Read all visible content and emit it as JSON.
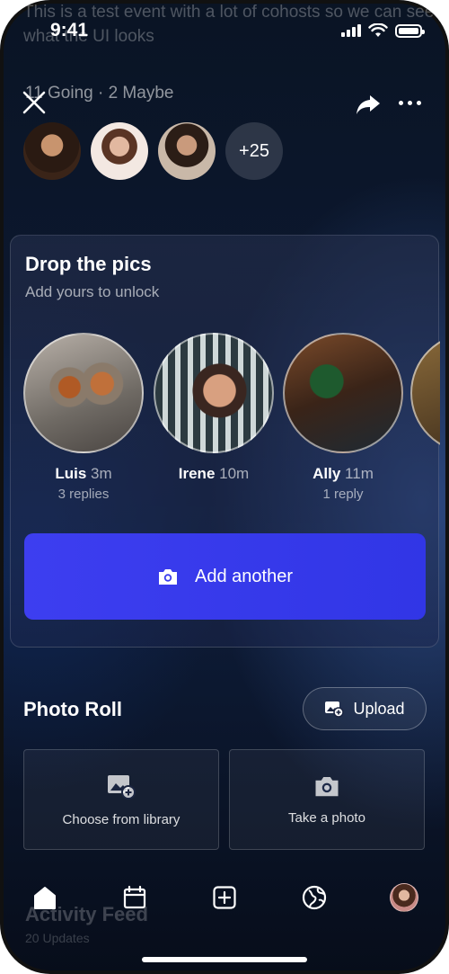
{
  "background": {
    "description": "This is a test event with a lot of cohosts so we can see what the UI looks",
    "feed_title": "Activity Feed",
    "feed_subtitle": "20 Updates"
  },
  "status_bar": {
    "time": "9:41"
  },
  "header": {
    "rsvp_summary": "11 Going · 2 Maybe",
    "more_count": "+25"
  },
  "drop_card": {
    "title": "Drop the pics",
    "subtitle": "Add yours to unlock",
    "pics": [
      {
        "name": "Luis",
        "time": "3m",
        "replies": "3 replies"
      },
      {
        "name": "Irene",
        "time": "10m",
        "replies": ""
      },
      {
        "name": "Ally",
        "time": "11m",
        "replies": "1 reply"
      }
    ],
    "add_button_label": "Add another"
  },
  "photo_roll": {
    "title": "Photo Roll",
    "upload_label": "Upload",
    "library_label": "Choose from library",
    "camera_label": "Take a photo"
  },
  "colors": {
    "accent": "#3d3ef0",
    "background": "#0c1830"
  },
  "icons": {
    "close": "close-icon",
    "share": "share-icon",
    "more": "more-icon",
    "camera": "camera-icon",
    "image_add": "image-add-icon",
    "tabs": [
      "home-icon",
      "calendar-icon",
      "plus-square-icon",
      "globe-icon",
      "profile-avatar"
    ]
  }
}
